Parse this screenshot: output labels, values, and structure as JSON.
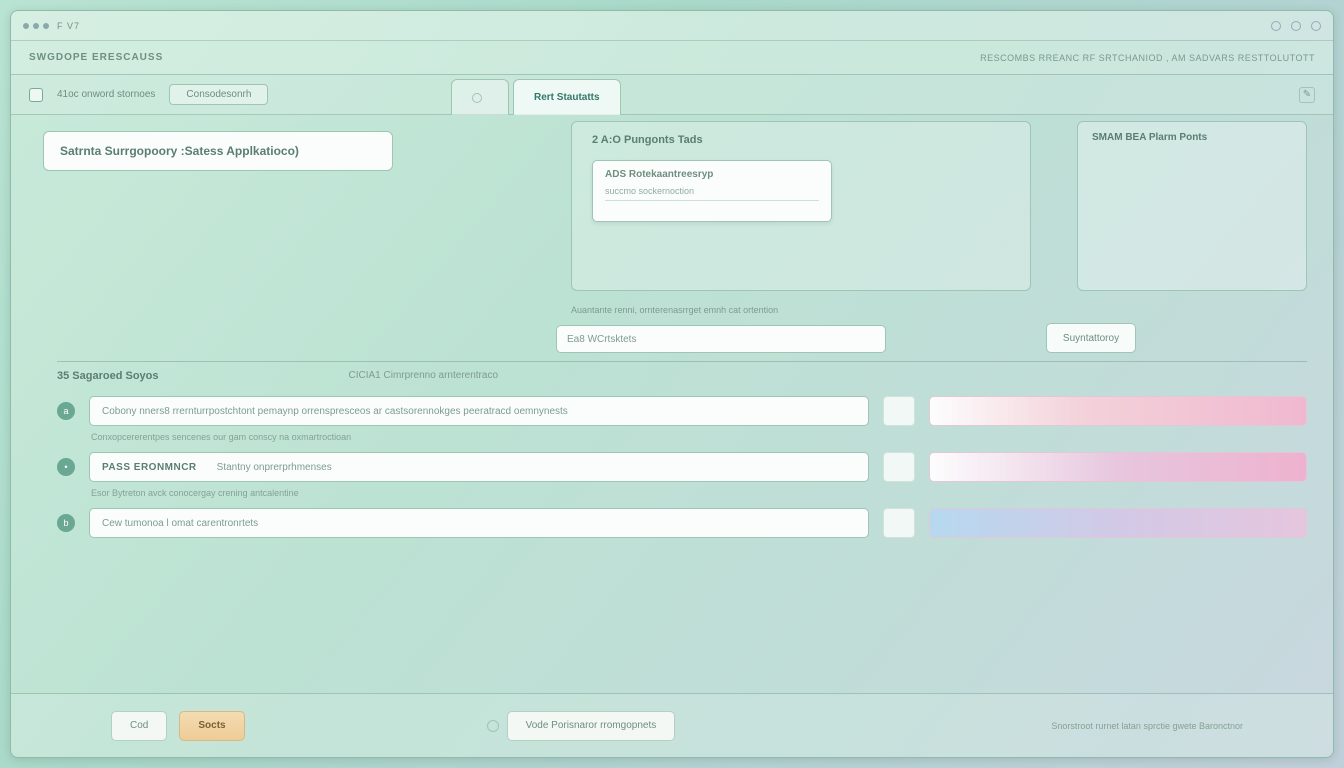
{
  "titlebar": {
    "text": "F V7"
  },
  "window_controls": {
    "min": "–",
    "max": "□",
    "close": "×"
  },
  "header": {
    "crumb_left": "SWGDOPE ERESCAUSS",
    "crumb_right": "RESCOMBS RREANC RF SRTCHANIOD , AM SADVARS RESTTOLUTOTT"
  },
  "toolbar": {
    "count_text": "41oc onword stornoes",
    "category_pill": "Consodesonrh",
    "tabs": [
      {
        "label": ""
      },
      {
        "label": "Rert Stautatts",
        "active": true
      }
    ],
    "edit_icon": "✎"
  },
  "top_left_box": {
    "title": "Satrnta Surrgopoory :Satess Applkatioco)"
  },
  "center_panel": {
    "title": "2 A:O Pungonts Tads",
    "dropdown": {
      "line1": "ADS Rotekaantreesryp",
      "line2": "succmo sockernoction"
    }
  },
  "side_panel": {
    "title": "SMAM BEA Plarm Ponts"
  },
  "mid": {
    "caption": "Auantante renni, ornterenasrrget emnh cat ortention",
    "input_text": "Ea8 WCrtsktets",
    "button": "Suyntattoroy"
  },
  "section": {
    "h1": "35 Sagaroed Soyos",
    "h2": "CICIA1 Cimrprenno arnterentraco",
    "rows": [
      {
        "step": "a",
        "lead": "",
        "text": "Cobony nners8 rrernturrpostchtont pemaynp orrenspresceos ar castsorennokges peeratracd oemnynests",
        "sub": "Conxopcererentpes sencenes our gam conscy na oxmartroctioan"
      },
      {
        "step": "•",
        "lead": "PASS ERONMNCR",
        "text": "Stantny onprerprhmenses",
        "sub": "Esor Bytreton avck conocergay crening antcalentine"
      },
      {
        "step": "b",
        "lead": "",
        "text": "Cew tumonoa l omat carentronrtets",
        "sub": ""
      }
    ]
  },
  "footer": {
    "cancel": "Cod",
    "save": "Socts",
    "mid_text": "Vode Porisnaror rromgopnets",
    "right_text": "Snorstroot rurnet latan sprctie gwete Baronctnor"
  }
}
